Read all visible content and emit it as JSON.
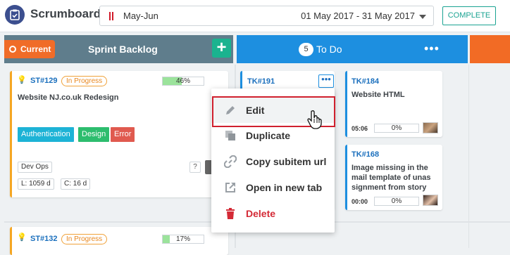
{
  "app": {
    "title": "Scrumboard"
  },
  "sprint": {
    "name": "May-Jun",
    "range": "01 May 2017 - 31 May 2017"
  },
  "header": {
    "complete_label": "COMPLETE"
  },
  "columns": {
    "backlog": {
      "badge": "Current",
      "title": "Sprint Backlog",
      "add_label": "+"
    },
    "todo": {
      "count": "5",
      "title": "To Do",
      "more_label": "•••"
    }
  },
  "cards": {
    "story1": {
      "id": "ST#129",
      "status": "In Progress",
      "progress_label": "46%",
      "progress": 46,
      "title": "Website NJ.co.uk Redesign",
      "tags": [
        {
          "label": "Authentication",
          "color": "#1db3d6"
        },
        {
          "label": "Design",
          "color": "#2dbd6e"
        },
        {
          "label": "Error",
          "color": "#e05a4f"
        }
      ],
      "team": "Dev Ops",
      "help": "?",
      "lead_time": "L: 1059 d",
      "cycle_time": "C: 16 d"
    },
    "story2": {
      "id": "ST#132",
      "status": "In Progress",
      "progress_label": "17%",
      "progress": 17
    },
    "task191": {
      "id": "TK#191",
      "more_label": "•••"
    },
    "task184": {
      "id": "TK#184",
      "title": "Website HTML",
      "time": "05:06",
      "progress_label": "0%",
      "progress": 0
    },
    "task168": {
      "id": "TK#168",
      "title": "Image missing in the mail template of unas signment from story",
      "time": "00:00",
      "progress_label": "0%",
      "progress": 0
    }
  },
  "context_menu": {
    "items": [
      {
        "label": "Edit",
        "icon": "pencil-icon"
      },
      {
        "label": "Duplicate",
        "icon": "copy-icon"
      },
      {
        "label": "Copy subitem url",
        "icon": "link-icon"
      },
      {
        "label": "Open in new tab",
        "icon": "external-link-icon"
      },
      {
        "label": "Delete",
        "icon": "trash-icon"
      }
    ]
  },
  "colors": {
    "accent_teal": "#1aa392",
    "todo_blue": "#1d8fe0",
    "backlog_slate": "#5f7d8c",
    "orange": "#f06c28",
    "danger": "#d42a36"
  }
}
